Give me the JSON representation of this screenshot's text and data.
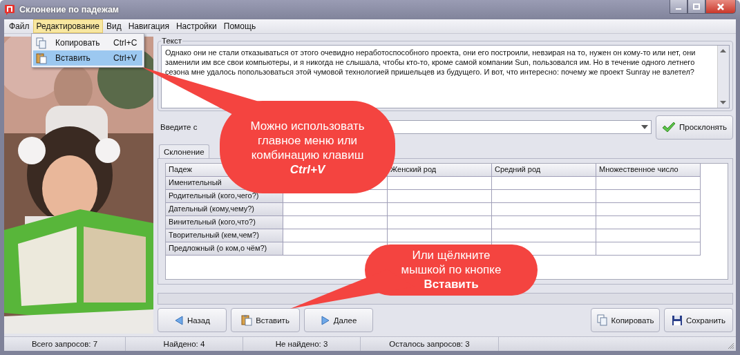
{
  "window": {
    "title": "Склонение по падежам"
  },
  "menu": [
    {
      "label": "Файл",
      "selected": false
    },
    {
      "label": "Редактирование",
      "selected": true
    },
    {
      "label": "Вид",
      "selected": false
    },
    {
      "label": "Навигация",
      "selected": false
    },
    {
      "label": "Настройки",
      "selected": false
    },
    {
      "label": "Помощь",
      "selected": false
    }
  ],
  "dropdown": [
    {
      "label": "Копировать",
      "shortcut": "Ctrl+C",
      "kind": "copy",
      "selected": false
    },
    {
      "label": "Вставить",
      "shortcut": "Ctrl+V",
      "kind": "paste",
      "selected": true
    }
  ],
  "text_group": {
    "legend": "Текст",
    "value": "Однако они не стали отказываться от этого очевидно неработоспособного проекта, они его построили, невзирая на то, нужен он кому-то или нет, они заменили им все свои компьютеры, и я никогда не слышала, чтобы кто-то, кроме самой компании Sun, пользовался им. Но в течение одного летнего сезона мне удалось попользоваться этой чумовой технологией пришельцев из будущего. И вот, что интересно: почему же проект Sunray не взлетел?"
  },
  "word_input": {
    "label": "Введите с"
  },
  "decline_button": {
    "label": "Просклонять"
  },
  "tabs": [
    {
      "label": "Склонение",
      "selected": true
    }
  ],
  "table": {
    "columns": [
      {
        "kind": "header",
        "label": "Падеж"
      },
      {
        "kind": "covered"
      },
      {
        "kind": "header",
        "label": "Женский род"
      },
      {
        "kind": "header",
        "label": "Средний род"
      },
      {
        "kind": "header",
        "label": "Множественное число"
      }
    ],
    "rows": [
      "Именительный",
      "Родительный (кого,чего?)",
      "Дательный (кому,чему?)",
      "Винительный (кого,что?)",
      "Творительный (кем,чем?)",
      "Предложный (о ком,о чём?)"
    ]
  },
  "nav_buttons": [
    {
      "label": "Назад",
      "kind": "back"
    },
    {
      "label": "Вставить",
      "kind": "paste"
    },
    {
      "label": "Далее",
      "kind": "forward"
    }
  ],
  "action_buttons": [
    {
      "label": "Копировать",
      "kind": "copy"
    },
    {
      "label": "Сохранить",
      "kind": "save"
    }
  ],
  "status_bar": [
    "Всего запросов: 7",
    "Найдено: 4",
    "Не найдено: 3",
    "Осталось запросов: 3"
  ],
  "callouts": [
    {
      "text": "Можно использовать главное меню или комбинацию клавиш",
      "emphasis": "Ctrl+V",
      "kind": "shortcut"
    },
    {
      "text": "Или щёлкните мышкой по кнопке",
      "emphasis": "Вставить",
      "kind": "button"
    }
  ]
}
